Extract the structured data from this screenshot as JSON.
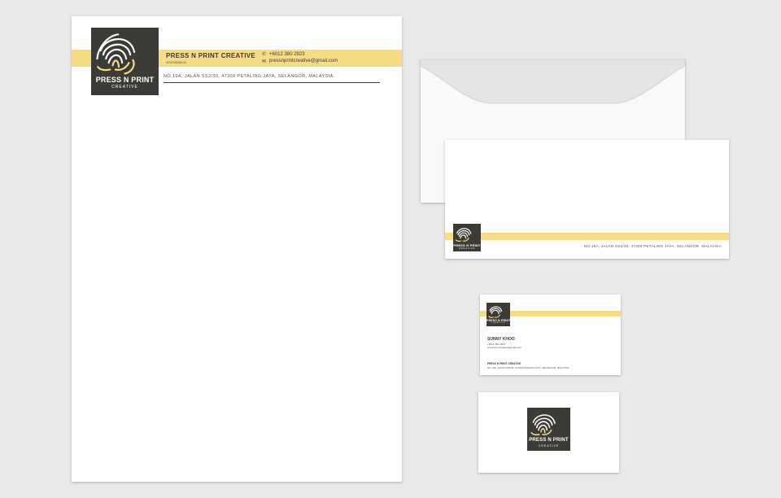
{
  "brand": {
    "name": "PRESS N PRINT",
    "tagline": "CREATIVE",
    "company": "PRESS N PRINT CREATIVE",
    "registration": "002195560-M",
    "phone": "+6012 380 2823",
    "email": "pressnprintcreative@gmail.com",
    "address": "NO.19A, JALAN SS2/30, 47300 PETALING JAYA, SELANGOR, MALAYSIA."
  },
  "icons": {
    "logo": "fingerprint-icon",
    "phone": "phone-icon",
    "email": "envelope-icon"
  },
  "colors": {
    "accent": "#f5dc85",
    "logo_bg": "#3c3b36",
    "background": "#e9e9e9"
  },
  "business_card": {
    "person_name": "SUNNY KHOO",
    "phone": "+6012 380 2823",
    "email": "pressnprintcreative@gmail.com",
    "company": "PRESS N PRINT CREATIVE",
    "address": "NO.19A, JALAN SS2/30, 47300 PETALING JAYA, SELANGOR, MALAYSIA.",
    "back_footer": "· · · · · · · · · · · ·"
  },
  "envelope": {
    "address": "NO.19A, JALAN SS2/30, 47300 PETALING JAYA, SELANGOR, MALAYSIA"
  }
}
